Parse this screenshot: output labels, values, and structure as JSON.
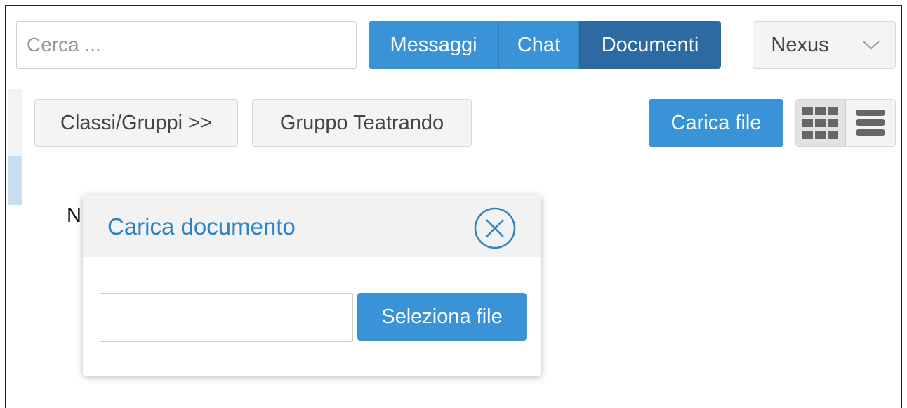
{
  "search": {
    "placeholder": "Cerca ...",
    "value": ""
  },
  "nav": {
    "tabs": [
      {
        "label": "Messaggi"
      },
      {
        "label": "Chat"
      },
      {
        "label": "Documenti",
        "active": true
      }
    ]
  },
  "profile_dropdown": {
    "label": "Nexus",
    "caret_icon": "chevron-down-icon"
  },
  "breadcrumb": {
    "items": [
      "Classi/Gruppi >>",
      "Gruppo Teatrando"
    ]
  },
  "toolbar": {
    "upload_label": "Carica file",
    "views": [
      "grid-view-icon",
      "list-view-icon"
    ]
  },
  "background_text": "N",
  "modal": {
    "title": "Carica documento",
    "close_icon": "close-circle-icon",
    "file_input_value": "",
    "select_label": "Seleziona file"
  },
  "colors": {
    "primary": "#3a93d6",
    "primary_active": "#2d6aa1",
    "title_blue": "#2b83c7"
  }
}
